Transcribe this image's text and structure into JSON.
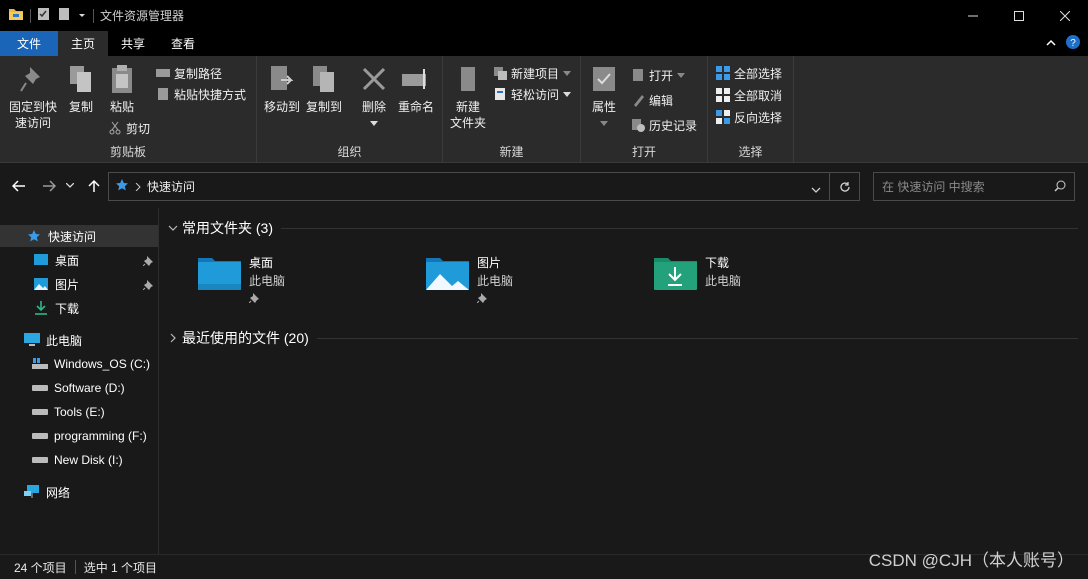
{
  "window": {
    "title": "文件资源管理器"
  },
  "tabs": [
    {
      "label": "文件"
    },
    {
      "label": "主页"
    },
    {
      "label": "共享"
    },
    {
      "label": "查看"
    }
  ],
  "ribbon": {
    "clipboard": {
      "label": "剪贴板",
      "pin": "固定到快\n速访问",
      "copy": "复制",
      "paste": "粘贴",
      "copy_path": "复制路径",
      "paste_shortcut": "粘贴快捷方式",
      "cut": "剪切"
    },
    "organize": {
      "label": "组织",
      "move_to": "移动到",
      "copy_to": "复制到",
      "delete": "删除",
      "rename": "重命名"
    },
    "new": {
      "label": "新建",
      "new_folder": "新建\n文件夹",
      "new_item": "新建项目",
      "easy_access": "轻松访问"
    },
    "open": {
      "label": "打开",
      "properties": "属性",
      "open": "打开",
      "edit": "编辑",
      "history": "历史记录"
    },
    "select": {
      "label": "选择",
      "select_all": "全部选择",
      "select_none": "全部取消",
      "invert": "反向选择"
    }
  },
  "address": {
    "path": "快速访问",
    "search_placeholder": "在 快速访问 中搜索"
  },
  "sidebar": {
    "quick_access": "快速访问",
    "items": [
      {
        "label": "桌面"
      },
      {
        "label": "图片"
      },
      {
        "label": "下载"
      }
    ],
    "this_pc": "此电脑",
    "drives": [
      {
        "label": "Windows_OS (C:)"
      },
      {
        "label": "Software (D:)"
      },
      {
        "label": "Tools (E:)"
      },
      {
        "label": "programming (F:)"
      },
      {
        "label": "New Disk (I:)"
      }
    ],
    "network": "网络"
  },
  "content": {
    "frequent_header": "常用文件夹 (3)",
    "recent_header": "最近使用的文件 (20)",
    "folders": [
      {
        "name": "桌面",
        "location": "此电脑",
        "color": "#1f9bd9"
      },
      {
        "name": "图片",
        "location": "此电脑",
        "color": "#1f9bd9"
      },
      {
        "name": "下载",
        "location": "此电脑",
        "color": "#22a17a"
      }
    ]
  },
  "status": {
    "items": "24 个项目",
    "selected": "选中 1 个项目"
  },
  "watermark": "CSDN @CJH（本人账号）"
}
